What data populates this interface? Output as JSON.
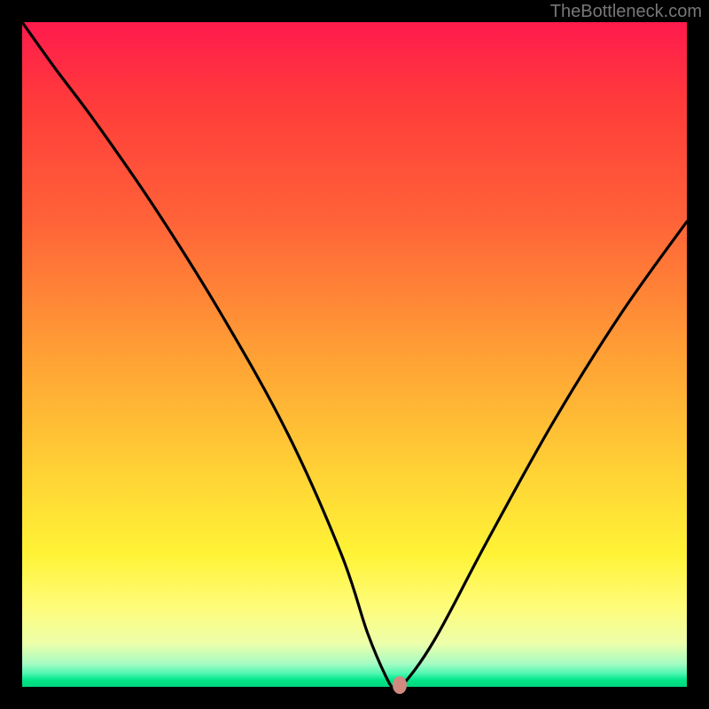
{
  "watermark": "TheBottleneck.com",
  "chart_data": {
    "type": "line",
    "title": "",
    "xlabel": "",
    "ylabel": "",
    "xlim": [
      0,
      100
    ],
    "ylim": [
      0,
      100
    ],
    "grid": false,
    "series": [
      {
        "name": "bottleneck-curve",
        "x": [
          0,
          5,
          11,
          20,
          30,
          40,
          48,
          52,
          55,
          56,
          57,
          62,
          70,
          80,
          90,
          100
        ],
        "values": [
          100,
          93,
          85,
          72,
          56,
          38,
          20,
          8,
          1,
          0,
          0,
          7,
          22,
          40,
          56,
          70
        ]
      }
    ],
    "marker": {
      "x": 56.8,
      "y": 0
    },
    "background_gradient": {
      "stops": [
        {
          "pos": 0,
          "color": "#ff1a4d"
        },
        {
          "pos": 0.12,
          "color": "#ff3b3b"
        },
        {
          "pos": 0.3,
          "color": "#ff6338"
        },
        {
          "pos": 0.5,
          "color": "#ffa035"
        },
        {
          "pos": 0.68,
          "color": "#ffd335"
        },
        {
          "pos": 0.8,
          "color": "#fff336"
        },
        {
          "pos": 0.88,
          "color": "#fffc7a"
        },
        {
          "pos": 0.935,
          "color": "#ecffaa"
        },
        {
          "pos": 0.965,
          "color": "#a7fcc4"
        },
        {
          "pos": 0.98,
          "color": "#4df7b0"
        },
        {
          "pos": 0.99,
          "color": "#00e588"
        },
        {
          "pos": 1.0,
          "color": "#00d47e"
        }
      ]
    }
  }
}
